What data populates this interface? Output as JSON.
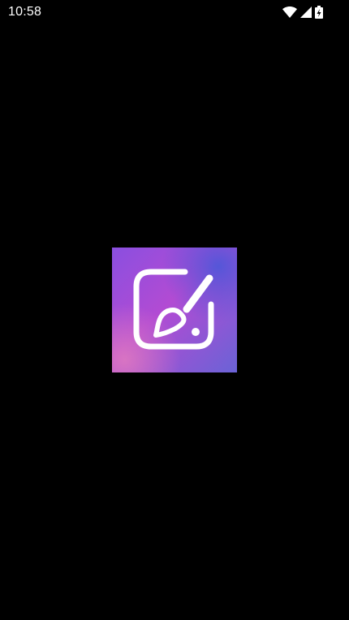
{
  "status_bar": {
    "time": "10:58",
    "icons": [
      "wifi-icon",
      "cellular-signal-icon",
      "battery-charging-icon"
    ]
  },
  "splash": {
    "logo_icon": "edit-brush-icon",
    "colors": {
      "background": "#000000",
      "logo_gradient_start": "#4f5bd8",
      "logo_gradient_mid": "#b24bd3",
      "logo_gradient_end": "#e07bc0",
      "logo_stroke": "#ffffff"
    }
  }
}
